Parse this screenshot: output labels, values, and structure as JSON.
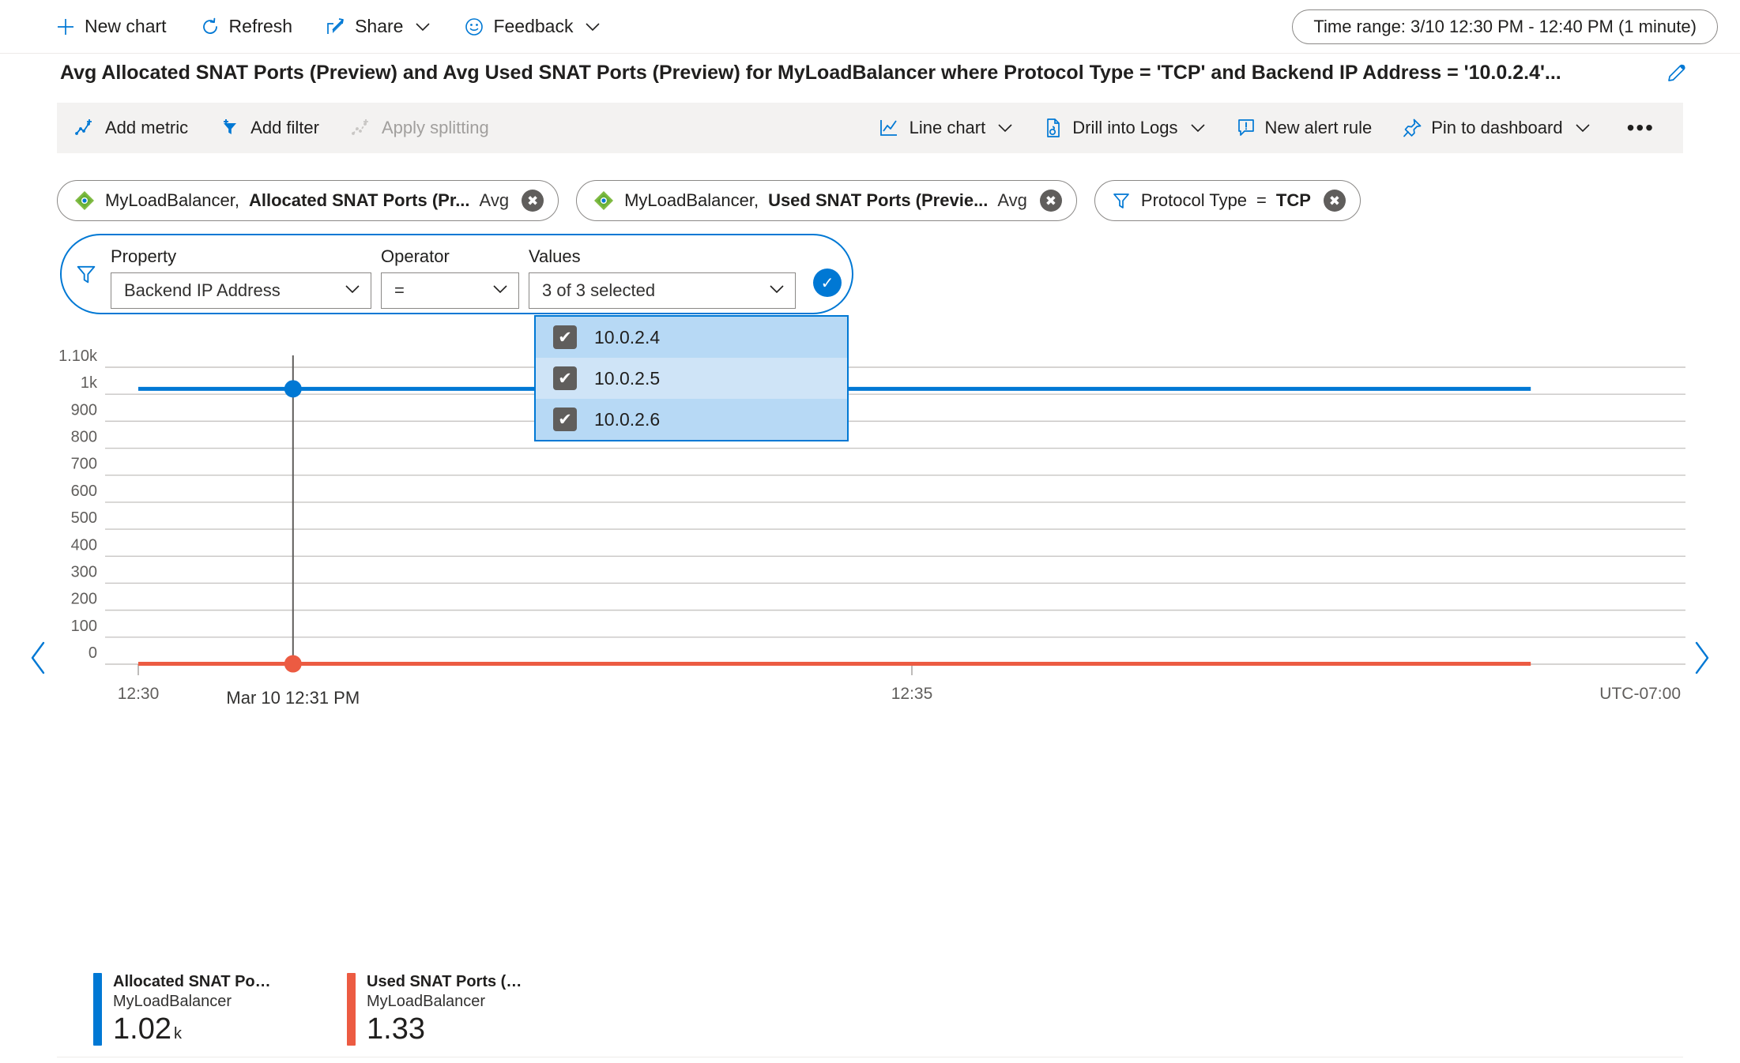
{
  "commandbar": {
    "buttons": [
      {
        "label": "New chart",
        "icon": "plus-icon",
        "chevron": false
      },
      {
        "label": "Refresh",
        "icon": "refresh-icon",
        "chevron": false
      },
      {
        "label": "Share",
        "icon": "share-icon",
        "chevron": true
      },
      {
        "label": "Feedback",
        "icon": "smiley-icon",
        "chevron": true
      }
    ],
    "time_range": "Time range: 3/10 12:30 PM - 12:40 PM (1 minute)"
  },
  "chart_header": {
    "title": "Avg Allocated SNAT Ports (Preview) and Avg Used SNAT Ports (Preview) for MyLoadBalancer where Protocol Type = 'TCP' and Backend IP Address = '10.0.2.4'...",
    "edit_icon": "pencil-icon"
  },
  "chart_toolbar": {
    "left": [
      {
        "label": "Add metric",
        "icon": "add-metric-icon",
        "disabled": false,
        "chevron": false
      },
      {
        "label": "Add filter",
        "icon": "add-filter-icon",
        "disabled": false,
        "chevron": false
      },
      {
        "label": "Apply splitting",
        "icon": "apply-splitting-icon",
        "disabled": true,
        "chevron": false
      }
    ],
    "right": [
      {
        "label": "Line chart",
        "icon": "line-chart-icon",
        "disabled": false,
        "chevron": true
      },
      {
        "label": "Drill into Logs",
        "icon": "drill-logs-icon",
        "disabled": false,
        "chevron": true
      },
      {
        "label": "New alert rule",
        "icon": "alert-rule-icon",
        "disabled": false,
        "chevron": false
      },
      {
        "label": "Pin to dashboard",
        "icon": "pin-icon",
        "disabled": false,
        "chevron": true
      }
    ],
    "more_label": "•••"
  },
  "chips": [
    {
      "kind": "metric",
      "icon": "load-balancer-icon",
      "resource": "MyLoadBalancer,",
      "metric": "Allocated SNAT Ports (Pr...",
      "aggregation": "Avg",
      "remove_icon": "close-icon"
    },
    {
      "kind": "metric",
      "icon": "load-balancer-icon",
      "resource": "MyLoadBalancer,",
      "metric": "Used SNAT Ports (Previe...",
      "aggregation": "Avg",
      "remove_icon": "close-icon"
    },
    {
      "kind": "filter",
      "icon": "funnel-icon",
      "property": "Protocol Type",
      "operator": "=",
      "value": "TCP",
      "remove_icon": "close-icon"
    }
  ],
  "filter_editor": {
    "funnel_icon": "funnel-icon",
    "property_label": "Property",
    "property_value": "Backend IP Address",
    "operator_label": "Operator",
    "operator_value": "=",
    "values_label": "Values",
    "values_value": "3 of 3 selected",
    "apply_icon": "check-icon",
    "chevron_icon": "chevron-down-icon",
    "options": [
      {
        "label": "10.0.2.4",
        "checked": true
      },
      {
        "label": "10.0.2.5",
        "checked": true
      },
      {
        "label": "10.0.2.6",
        "checked": true
      }
    ],
    "check_glyph": "✔"
  },
  "nav": {
    "prev_icon": "chevron-left-icon",
    "next_icon": "chevron-right-icon"
  },
  "legend": [
    {
      "color": "#0078d4",
      "name": "Allocated SNAT Ports...",
      "resource": "MyLoadBalancer",
      "value": "1.02",
      "unit": "k"
    },
    {
      "color": "#ec5b42",
      "name": "Used SNAT Ports (Pre...",
      "resource": "MyLoadBalancer",
      "value": "1.33",
      "unit": ""
    }
  ],
  "chart_data": {
    "type": "line",
    "title": "Avg Allocated SNAT Ports (Preview) and Avg Used SNAT Ports (Preview) for MyLoadBalancer where Protocol Type = 'TCP' and Backend IP Address = '10.0.2.4'...",
    "xlabel": "",
    "ylabel": "",
    "grid": true,
    "legend_position": "bottom",
    "timezone_label": "UTC-07:00",
    "ylim": [
      0,
      1100
    ],
    "yticks": [
      0,
      100,
      200,
      300,
      400,
      500,
      600,
      700,
      800,
      900,
      1000,
      1100
    ],
    "ytick_labels": [
      "0",
      "100",
      "200",
      "300",
      "400",
      "500",
      "600",
      "700",
      "800",
      "900",
      "1k",
      "1.10k"
    ],
    "xticks": [
      "12:30",
      "12:35"
    ],
    "xtick_positions": [
      0,
      5
    ],
    "xlim_minutes": [
      0,
      10
    ],
    "hover": {
      "label": "Mar 10 12:31 PM",
      "x_minutes": 1,
      "points": [
        {
          "series": "Allocated SNAT Ports (Preview)",
          "value": 1020
        },
        {
          "series": "Used SNAT Ports (Preview)",
          "value": 1.33
        }
      ]
    },
    "series": [
      {
        "name": "Allocated SNAT Ports (Preview)",
        "resource": "MyLoadBalancer",
        "color": "#0078d4",
        "x": [
          0,
          1,
          2,
          3,
          4,
          5,
          6,
          7,
          8,
          9
        ],
        "values": [
          1020,
          1020,
          1020,
          1020,
          1020,
          1020,
          1020,
          1020,
          1020,
          1020
        ]
      },
      {
        "name": "Used SNAT Ports (Preview)",
        "resource": "MyLoadBalancer",
        "color": "#ec5b42",
        "x": [
          0,
          1,
          2,
          3,
          4,
          5,
          6,
          7,
          8,
          9
        ],
        "values": [
          1.33,
          1.33,
          1.33,
          1.33,
          1.33,
          1.33,
          1.33,
          1.33,
          1.33,
          1.33
        ]
      }
    ]
  }
}
